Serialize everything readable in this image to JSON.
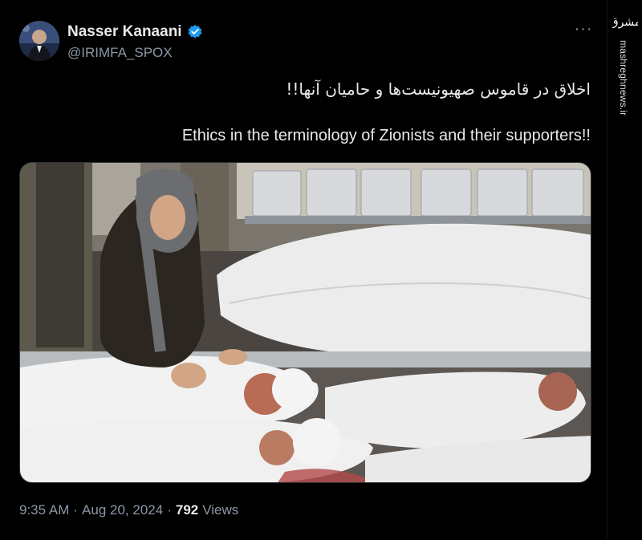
{
  "author": {
    "display_name": "Nasser Kanaani",
    "handle": "@IRIMFA_SPOX",
    "verified": true,
    "avatar_icon": "profile-photo"
  },
  "post": {
    "text_fa": "اخلاق در قاموس صهیونیست‌ها و حامیان آنها!!",
    "text_en": "!!Ethics in the terminology of Zionists and their supporters",
    "media_icon": "attached-photo"
  },
  "meta": {
    "time": "9:35 AM",
    "date": "Aug 20, 2024",
    "separator": "·",
    "views_count": "792",
    "views_label": "Views"
  },
  "watermark": {
    "logo_text": "مشرق",
    "site": "mashreghnews.ir"
  },
  "colors": {
    "background": "#000000",
    "primary_text": "#e7e9ea",
    "secondary_text": "#8b98a5",
    "verified_blue": "#1d9bf0"
  }
}
